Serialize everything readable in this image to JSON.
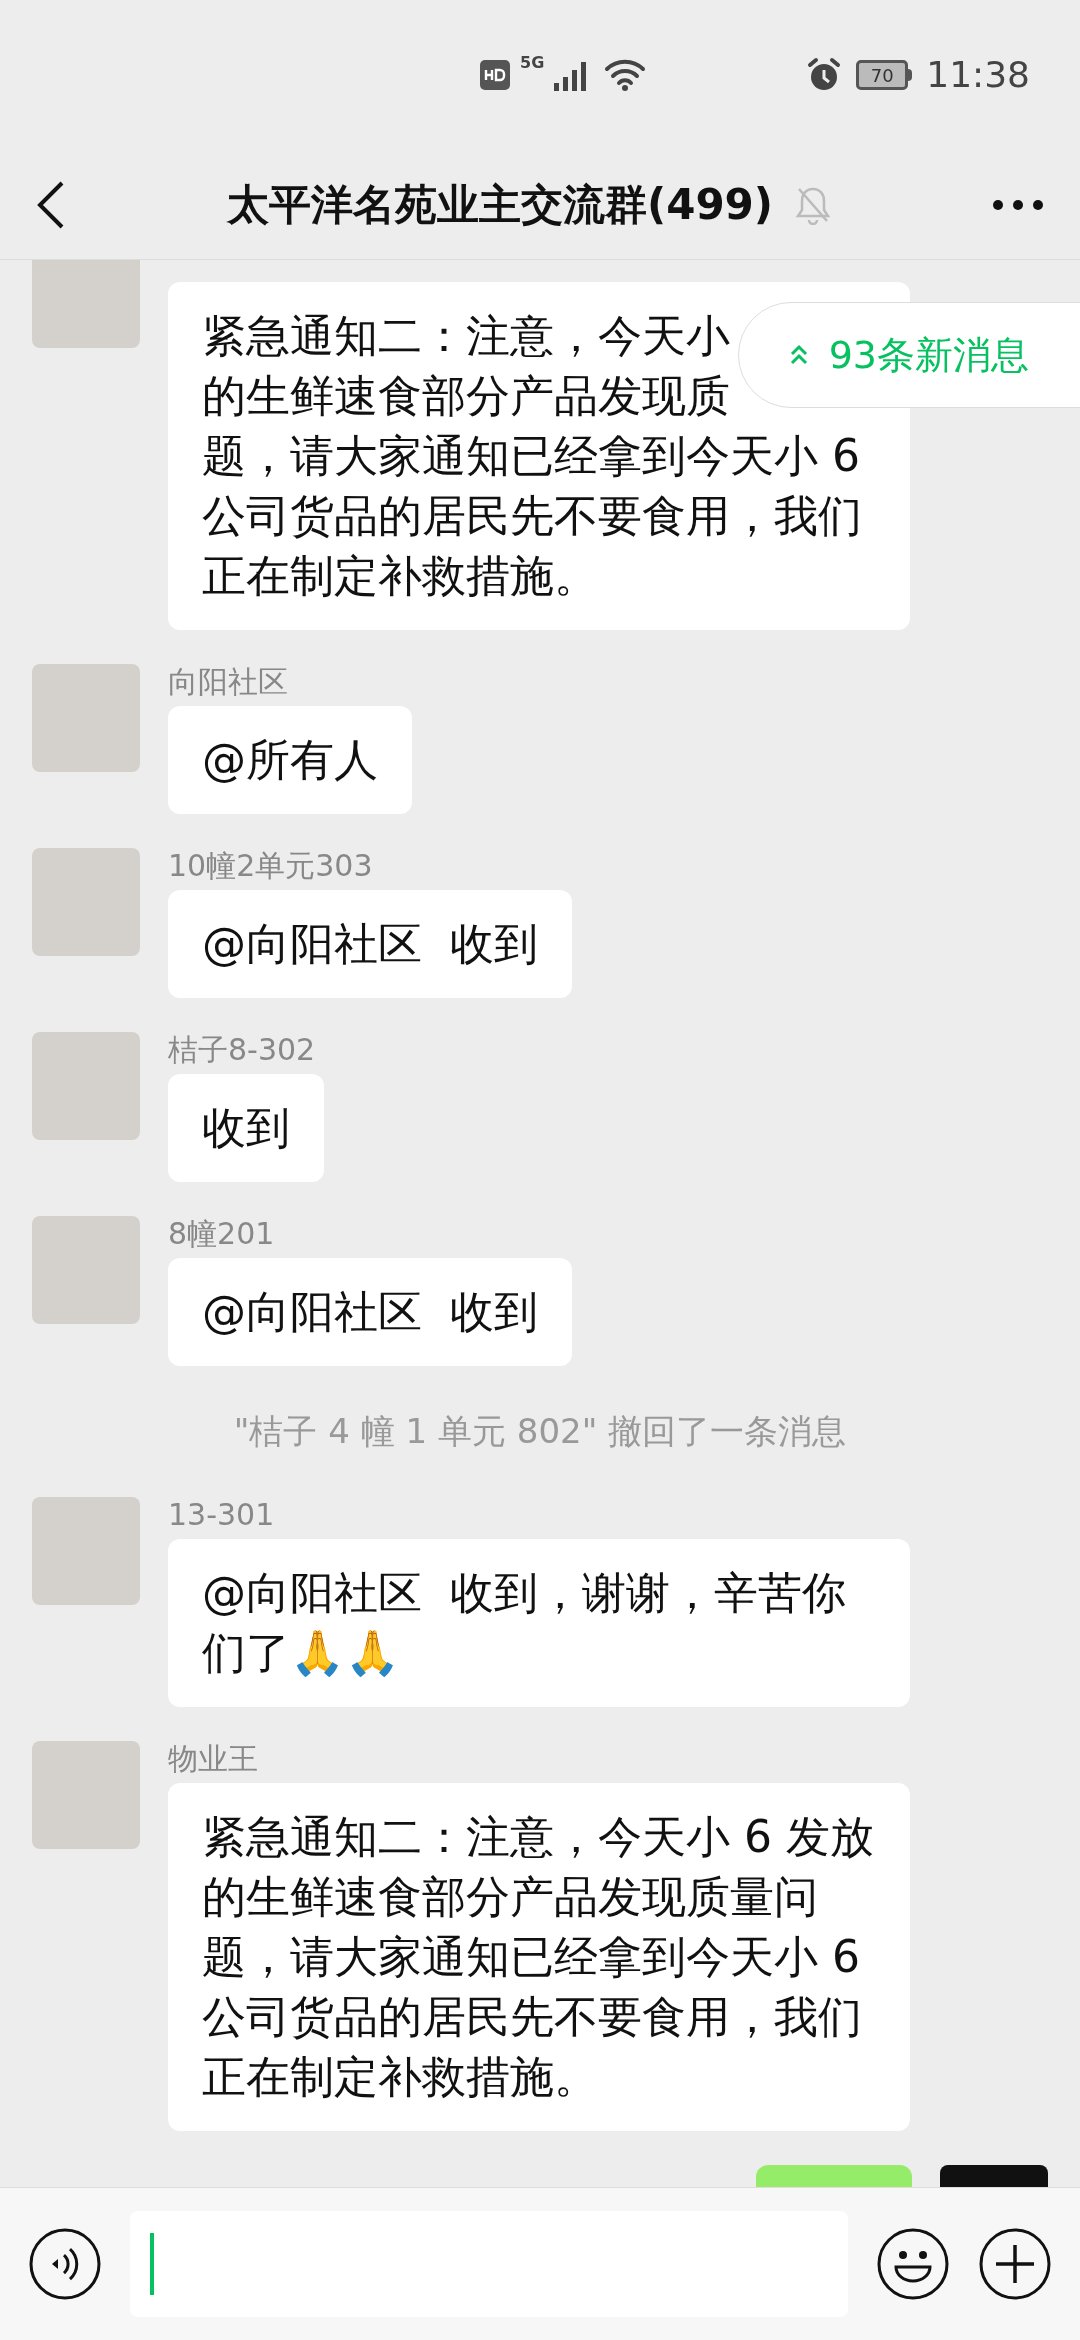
{
  "status_bar": {
    "network": "5G",
    "battery": "70",
    "time": "11:38"
  },
  "header": {
    "title": "太平洋名苑业主交流群(499)",
    "muted": true
  },
  "new_messages_pill": {
    "label": "93条新消息"
  },
  "messages": [
    {
      "kind": "message",
      "lines": [
        "紧急通知二：注意，今天小",
        "的生鲜速食部分产品发现质",
        "题，请大家通知已经拿到今天小 6",
        "公司货品的居民先不要食用，我们",
        "正在制定补救措施。"
      ]
    },
    {
      "kind": "message",
      "sender": "向阳社区",
      "text": "@所有人"
    },
    {
      "kind": "message",
      "sender": "10幢2单元303",
      "text": "@向阳社区  收到"
    },
    {
      "kind": "message",
      "sender": "桔子8-302",
      "text": "收到"
    },
    {
      "kind": "message",
      "sender": "8幢201",
      "text": "@向阳社区  收到"
    },
    {
      "kind": "notice",
      "text": "\"桔子 4 幢 1 单元 802\" 撤回了一条消息"
    },
    {
      "kind": "message",
      "sender": "13-301",
      "text": "@向阳社区  收到，谢谢，辛苦你们了🙏🙏"
    },
    {
      "kind": "message",
      "sender": "物业王",
      "text": "紧急通知二：注意，今天小 6 发放的生鲜速食部分产品发现质量问题，请大家通知已经拿到今天小 6 公司货品的居民先不要食用，我们正在制定补救措施。"
    },
    {
      "kind": "own"
    }
  ]
}
